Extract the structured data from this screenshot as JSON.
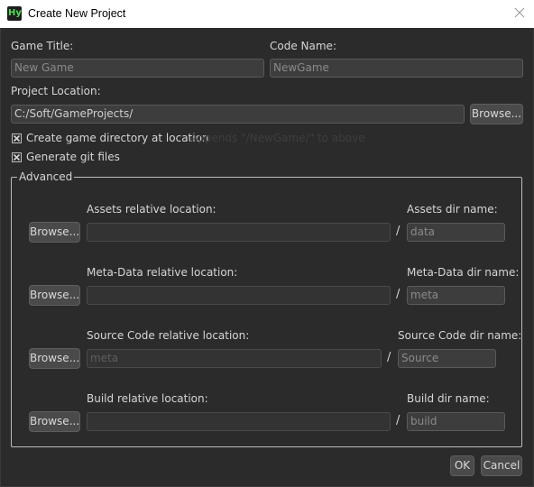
{
  "titlebar": {
    "icon_text": "Hy",
    "title": "Create New Project"
  },
  "fields": {
    "game_title_label": "Game Title:",
    "game_title_value": "New Game",
    "code_name_label": "Code Name:",
    "code_name_value": "NewGame",
    "project_location_label": "Project Location:",
    "project_location_value": "C:/Soft/GameProjects/",
    "browse_label": "Browse..."
  },
  "options": {
    "create_dir_label": "Create game directory at location",
    "create_dir_checked": true,
    "create_dir_hint": "Appends \"/NewGame/\" to above",
    "git_label": "Generate git files",
    "git_checked": true
  },
  "advanced": {
    "title": "Advanced",
    "slash": "/",
    "rows": [
      {
        "rel_label": "Assets relative location:",
        "rel_value": "",
        "dir_label": "Assets dir name:",
        "dir_value": "data",
        "browse": "Browse..."
      },
      {
        "rel_label": "Meta-Data relative location:",
        "rel_value": "",
        "dir_label": "Meta-Data dir name:",
        "dir_value": "meta",
        "browse": "Browse..."
      },
      {
        "rel_label": "Source Code relative location:",
        "rel_value": "meta",
        "dir_label": "Source Code dir name:",
        "dir_value": "Source",
        "browse": "Browse..."
      },
      {
        "rel_label": "Build relative location:",
        "rel_value": "",
        "dir_label": "Build dir name:",
        "dir_value": "build",
        "browse": "Browse..."
      }
    ]
  },
  "buttons": {
    "ok": "OK",
    "cancel": "Cancel"
  }
}
